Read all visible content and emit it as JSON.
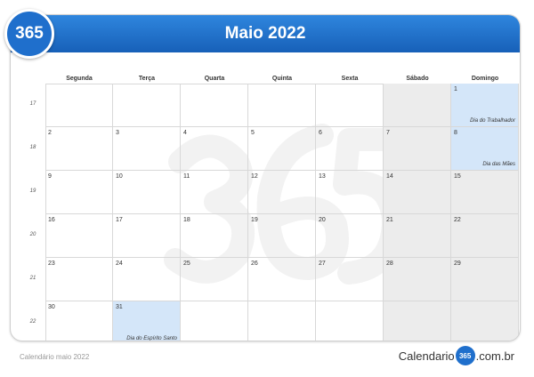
{
  "header": {
    "logo": "365",
    "title": "Maio 2022"
  },
  "weekdays": [
    "Segunda",
    "Terça",
    "Quarta",
    "Quinta",
    "Sexta",
    "Sábado",
    "Domingo"
  ],
  "week_numbers": [
    "17",
    "18",
    "19",
    "20",
    "21",
    "22"
  ],
  "weeks": [
    [
      {
        "day": "",
        "holiday": ""
      },
      {
        "day": "",
        "holiday": ""
      },
      {
        "day": "",
        "holiday": ""
      },
      {
        "day": "",
        "holiday": ""
      },
      {
        "day": "",
        "holiday": ""
      },
      {
        "day": "",
        "holiday": ""
      },
      {
        "day": "1",
        "holiday": "Dia do Trabalhador"
      }
    ],
    [
      {
        "day": "2",
        "holiday": ""
      },
      {
        "day": "3",
        "holiday": ""
      },
      {
        "day": "4",
        "holiday": ""
      },
      {
        "day": "5",
        "holiday": ""
      },
      {
        "day": "6",
        "holiday": ""
      },
      {
        "day": "7",
        "holiday": ""
      },
      {
        "day": "8",
        "holiday": "Dia das Mães"
      }
    ],
    [
      {
        "day": "9",
        "holiday": ""
      },
      {
        "day": "10",
        "holiday": ""
      },
      {
        "day": "11",
        "holiday": ""
      },
      {
        "day": "12",
        "holiday": ""
      },
      {
        "day": "13",
        "holiday": ""
      },
      {
        "day": "14",
        "holiday": ""
      },
      {
        "day": "15",
        "holiday": ""
      }
    ],
    [
      {
        "day": "16",
        "holiday": ""
      },
      {
        "day": "17",
        "holiday": ""
      },
      {
        "day": "18",
        "holiday": ""
      },
      {
        "day": "19",
        "holiday": ""
      },
      {
        "day": "20",
        "holiday": ""
      },
      {
        "day": "21",
        "holiday": ""
      },
      {
        "day": "22",
        "holiday": ""
      }
    ],
    [
      {
        "day": "23",
        "holiday": ""
      },
      {
        "day": "24",
        "holiday": ""
      },
      {
        "day": "25",
        "holiday": ""
      },
      {
        "day": "26",
        "holiday": ""
      },
      {
        "day": "27",
        "holiday": ""
      },
      {
        "day": "28",
        "holiday": ""
      },
      {
        "day": "29",
        "holiday": ""
      }
    ],
    [
      {
        "day": "30",
        "holiday": ""
      },
      {
        "day": "31",
        "holiday": "Dia do Espírito Santo"
      },
      {
        "day": "",
        "holiday": ""
      },
      {
        "day": "",
        "holiday": ""
      },
      {
        "day": "",
        "holiday": ""
      },
      {
        "day": "",
        "holiday": ""
      },
      {
        "day": "",
        "holiday": ""
      }
    ]
  ],
  "footer": {
    "caption": "Calendário maio 2022",
    "brand_prefix": "Calendario",
    "brand_number": "365",
    "brand_suffix": ".com.br"
  },
  "colors": {
    "header": "#1f6fcc",
    "weekend": "#ececec",
    "holiday": "#d4e6f9"
  }
}
